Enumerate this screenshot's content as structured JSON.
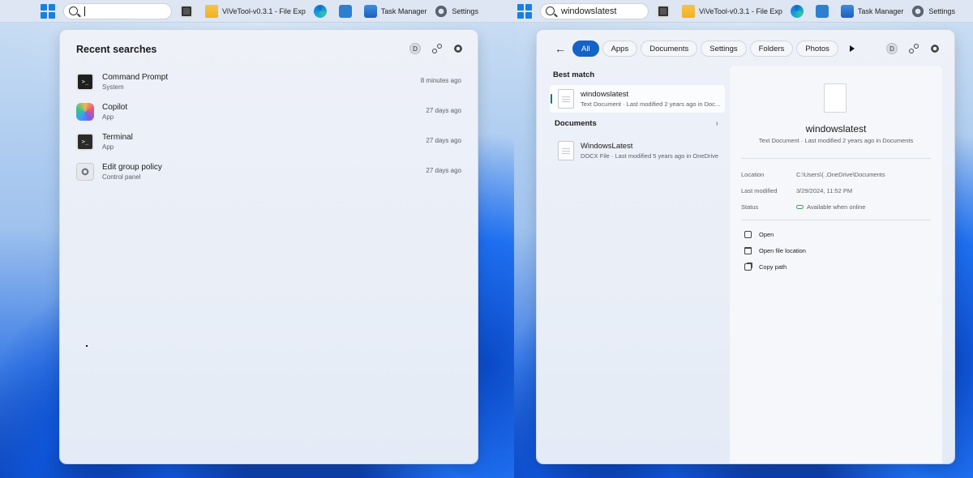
{
  "taskbar": {
    "left_search_value": "",
    "right_search_value": "windowslatest",
    "apps": [
      {
        "icon": "widgets-icon",
        "label": ""
      },
      {
        "icon": "folder-icon",
        "label": "ViVeTool-v0.3.1 - File Exp"
      },
      {
        "icon": "edge-icon",
        "label": ""
      },
      {
        "icon": "store-icon",
        "label": ""
      },
      {
        "icon": "task-manager-icon",
        "label": "Task Manager"
      },
      {
        "icon": "settings-gear-icon",
        "label": "Settings"
      }
    ]
  },
  "left_panel": {
    "title": "Recent searches",
    "avatar_letter": "D",
    "items": [
      {
        "name": "Command Prompt",
        "sub": "System",
        "time": "8 minutes ago",
        "icon": "command-prompt-icon"
      },
      {
        "name": "Copilot",
        "sub": "App",
        "time": "27 days ago",
        "icon": "copilot-icon"
      },
      {
        "name": "Terminal",
        "sub": "App",
        "time": "27 days ago",
        "icon": "terminal-icon"
      },
      {
        "name": "Edit group policy",
        "sub": "Control panel",
        "time": "27 days ago",
        "icon": "group-policy-icon"
      }
    ]
  },
  "right_panel": {
    "avatar_letter": "D",
    "filters": [
      "All",
      "Apps",
      "Documents",
      "Settings",
      "Folders",
      "Photos"
    ],
    "active_filter": "All",
    "best_match_label": "Best match",
    "best_match": {
      "name": "windowslatest",
      "sub": "Text Document · Last modified 2 years ago in Doc..."
    },
    "documents_label": "Documents",
    "documents": [
      {
        "name": "WindowsLatest",
        "sub": "DOCX File · Last modified 5 years ago in OneDrive"
      }
    ],
    "detail": {
      "name": "windowslatest",
      "sub": "Text Document · Last modified 2 years ago in Documents",
      "location_label": "Location",
      "location_value": "C:\\Users\\(        ,OneDrive\\Documents",
      "modified_label": "Last modified",
      "modified_value": "3/29/2024, 11:52 PM",
      "status_label": "Status",
      "status_value": "Available when online",
      "actions": [
        "Open",
        "Open file location",
        "Copy path"
      ]
    }
  }
}
